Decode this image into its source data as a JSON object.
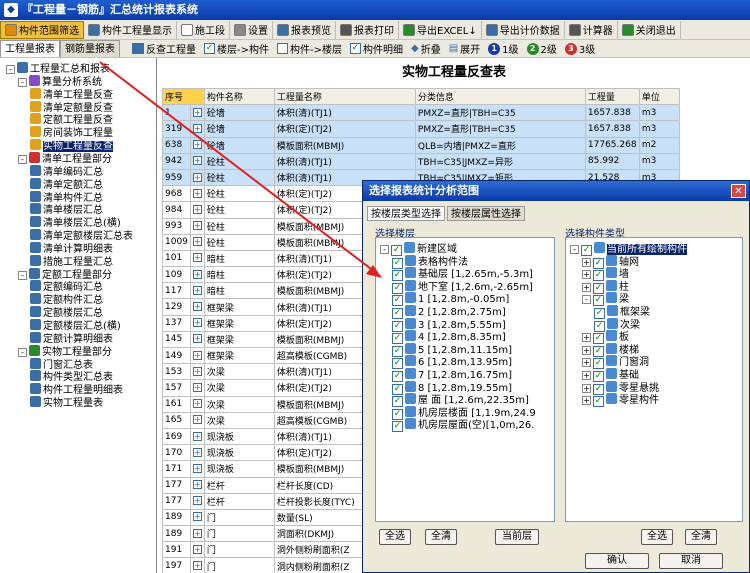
{
  "window": {
    "title": "『工程量－钢筋』汇总统计报表系统"
  },
  "toolbar": [
    {
      "label": "构件范围筛选",
      "icon": "filter-icon",
      "color": "#e08a00"
    },
    {
      "label": "构件工程量显示",
      "icon": "table-icon",
      "color": "#3a6ea5"
    },
    {
      "label": "施工段",
      "icon": "checkbox-icon",
      "color": "#ffffff"
    },
    {
      "label": "设置",
      "icon": "gear-icon",
      "color": "#888888"
    },
    {
      "label": "报表预览",
      "icon": "preview-icon",
      "color": "#3a6ea5"
    },
    {
      "label": "报表打印",
      "icon": "print-icon",
      "color": "#555555"
    },
    {
      "label": "导出EXCEL↓",
      "icon": "excel-icon",
      "color": "#2a8a2a"
    },
    {
      "label": "导出计价数据",
      "icon": "export-icon",
      "color": "#3a6ea5"
    },
    {
      "label": "计算器",
      "icon": "calculator-icon",
      "color": "#555555"
    },
    {
      "label": "关闭退出",
      "icon": "close-icon",
      "color": "#2a8a2a"
    }
  ],
  "left_tabs": [
    "工程量报表",
    "钢筋量报表"
  ],
  "toolbar2": {
    "reverse": "反查工程量",
    "floor_to_comp": "楼层->构件",
    "comp_to_floor": "构件->楼层",
    "comp_detail": "构件明细",
    "collapse": "折叠",
    "expand": "展开",
    "level1": "1级",
    "level2": "2级",
    "level3": "3级"
  },
  "tree": [
    {
      "label": "工程量汇总和报表",
      "level": 0,
      "exp": "-",
      "color": "#3a6ea5"
    },
    {
      "label": "算量分析系统",
      "level": 1,
      "exp": "-",
      "color": "#8a4ac8"
    },
    {
      "label": "清单工程量反查",
      "level": 2,
      "color": "#e0a020"
    },
    {
      "label": "清单定额量反查",
      "level": 2,
      "color": "#e0a020"
    },
    {
      "label": "定额工程量反查",
      "level": 2,
      "color": "#e0a020"
    },
    {
      "label": "房间装饰工程量",
      "level": 2,
      "color": "#e0a020"
    },
    {
      "label": "实物工程量反查",
      "level": 2,
      "color": "#e0a020",
      "selected": true
    },
    {
      "label": "清单工程量部分",
      "level": 1,
      "exp": "-",
      "color": "#d03030"
    },
    {
      "label": "清单编码汇总",
      "level": 2,
      "color": "#3a6ea5"
    },
    {
      "label": "清单定额汇总",
      "level": 2,
      "color": "#3a6ea5"
    },
    {
      "label": "清单构件汇总",
      "level": 2,
      "color": "#3a6ea5"
    },
    {
      "label": "清单楼层汇总",
      "level": 2,
      "color": "#3a6ea5"
    },
    {
      "label": "清单楼层汇总(横)",
      "level": 2,
      "color": "#3a6ea5"
    },
    {
      "label": "清单定额楼层汇总表",
      "level": 2,
      "color": "#3a6ea5"
    },
    {
      "label": "清单计算明细表",
      "level": 2,
      "color": "#3a6ea5"
    },
    {
      "label": "措施工程量汇总",
      "level": 2,
      "color": "#3a6ea5"
    },
    {
      "label": "定额工程量部分",
      "level": 1,
      "exp": "-",
      "color": "#3a6ea5"
    },
    {
      "label": "定额编码汇总",
      "level": 2,
      "color": "#3a6ea5"
    },
    {
      "label": "定额构件汇总",
      "level": 2,
      "color": "#3a6ea5"
    },
    {
      "label": "定额楼层汇总",
      "level": 2,
      "color": "#3a6ea5"
    },
    {
      "label": "定额楼层汇总(横)",
      "level": 2,
      "color": "#3a6ea5"
    },
    {
      "label": "定额计算明细表",
      "level": 2,
      "color": "#3a6ea5"
    },
    {
      "label": "实物工程量部分",
      "level": 1,
      "exp": "-",
      "color": "#2a8a2a"
    },
    {
      "label": "门窗汇总表",
      "level": 2,
      "color": "#3a6ea5"
    },
    {
      "label": "构件类型汇总表",
      "level": 2,
      "color": "#3a6ea5"
    },
    {
      "label": "构件工程量明细表",
      "level": 2,
      "color": "#3a6ea5"
    },
    {
      "label": "实物工程量表",
      "level": 2,
      "color": "#3a6ea5"
    }
  ],
  "report": {
    "title": "实物工程量反查表",
    "headers": [
      "序号",
      "构件名称",
      "工程量名称",
      "分类信息",
      "工程量",
      "单位"
    ],
    "rows": [
      [
        "1",
        "砼墙",
        "体积(清)(TJ1)",
        "PMXZ=直形|TBH=C35",
        "1657.838",
        "m3"
      ],
      [
        "319",
        "砼墙",
        "体积(定)(TJ2)",
        "PMXZ=直形|TBH=C35",
        "1657.838",
        "m3"
      ],
      [
        "638",
        "砼墙",
        "模板面积(MBMJ)",
        "QLB=内墙|PMXZ=直形",
        "17765.268",
        "m2"
      ],
      [
        "942",
        "砼柱",
        "体积(清)(TJ1)",
        "TBH=C35|JMXZ=异形",
        "85.992",
        "m3"
      ],
      [
        "959",
        "砼柱",
        "体积(清)(TJ1)",
        "TBH=C35|JMXZ=矩形",
        "21.528",
        "m3"
      ],
      [
        "968",
        "砼柱",
        "体积(定)(TJ2)",
        "",
        "",
        ""
      ],
      [
        "984",
        "砼柱",
        "体积(定)(TJ2)",
        "",
        "",
        ""
      ],
      [
        "993",
        "砼柱",
        "模板面积(MBMJ)",
        "",
        "",
        ""
      ],
      [
        "1009",
        "砼柱",
        "模板面积(MBMJ)",
        "",
        "",
        ""
      ],
      [
        "101",
        "暗柱",
        "体积(清)(TJ1)",
        "",
        "",
        ""
      ],
      [
        "109",
        "暗柱",
        "体积(定)(TJ2)",
        "",
        "",
        ""
      ],
      [
        "117",
        "暗柱",
        "模板面积(MBMJ)",
        "",
        "",
        ""
      ],
      [
        "129",
        "框架梁",
        "体积(清)(TJ1)",
        "",
        "",
        ""
      ],
      [
        "137",
        "框架梁",
        "体积(定)(TJ2)",
        "",
        "",
        ""
      ],
      [
        "145",
        "框架梁",
        "模板面积(MBMJ)",
        "",
        "",
        ""
      ],
      [
        "149",
        "框架梁",
        "超高模板(CGMB)",
        "",
        "",
        ""
      ],
      [
        "153",
        "次梁",
        "体积(清)(TJ1)",
        "",
        "",
        ""
      ],
      [
        "157",
        "次梁",
        "体积(定)(TJ2)",
        "",
        "",
        ""
      ],
      [
        "161",
        "次梁",
        "模板面积(MBMJ)",
        "",
        "",
        ""
      ],
      [
        "165",
        "次梁",
        "超高模板(CGMB)",
        "",
        "",
        ""
      ],
      [
        "169",
        "现浇板",
        "体积(清)(TJ1)",
        "",
        "",
        ""
      ],
      [
        "170",
        "现浇板",
        "体积(定)(TJ2)",
        "",
        "",
        ""
      ],
      [
        "171",
        "现浇板",
        "模板面积(MBMJ)",
        "",
        "",
        ""
      ],
      [
        "177",
        "栏杆",
        "栏杆长度(CD)",
        "",
        "",
        ""
      ],
      [
        "177",
        "栏杆",
        "栏杆投影长度(TYC)",
        "",
        "",
        ""
      ],
      [
        "189",
        "门",
        "数量(SL)",
        "",
        "",
        ""
      ],
      [
        "189",
        "门",
        "洞面积(DKMJ)",
        "",
        "",
        ""
      ],
      [
        "191",
        "门",
        "洞外侧粉刷面积(Z",
        "",
        "",
        ""
      ],
      [
        "197",
        "门",
        "洞内侧粉刷面积(Z",
        "",
        "",
        ""
      ]
    ]
  },
  "dialog": {
    "title": "选择报表统计分析范围",
    "tabs": [
      "按楼层类型选择",
      "按楼层属性选择"
    ],
    "floors_label": "选择楼层",
    "components_label": "选择构件类型",
    "floors": [
      {
        "label": "新建区域",
        "level": 0,
        "exp": "-"
      },
      {
        "label": "表格构件法",
        "level": 1
      },
      {
        "label": "基础层 [1,2.65m,-5.3m]",
        "level": 1
      },
      {
        "label": "地下室 [1,2.6m,-2.65m]",
        "level": 1
      },
      {
        "label": "1 [1,2.8m,-0.05m]",
        "level": 1
      },
      {
        "label": "2 [1,2.8m,2.75m]",
        "level": 1
      },
      {
        "label": "3 [1,2.8m,5.55m]",
        "level": 1
      },
      {
        "label": "4 [1,2.8m,8.35m]",
        "level": 1
      },
      {
        "label": "5 [1,2.8m,11.15m]",
        "level": 1
      },
      {
        "label": "6 [1,2.8m,13.95m]",
        "level": 1
      },
      {
        "label": "7 [1,2.8m,16.75m]",
        "level": 1
      },
      {
        "label": "8 [1,2.8m,19.55m]",
        "level": 1
      },
      {
        "label": "屋 面 [1,2.6m,22.35m]",
        "level": 1
      },
      {
        "label": "机房层楼面 [1,1.9m,24.9",
        "level": 1
      },
      {
        "label": "机房层屋面(空)[1,0m,26.",
        "level": 1
      }
    ],
    "components": [
      {
        "label": "当前所有绘制构件",
        "level": 0,
        "exp": "-",
        "selected": true
      },
      {
        "label": "轴网",
        "level": 1,
        "exp": "+"
      },
      {
        "label": "墙",
        "level": 1,
        "exp": "+"
      },
      {
        "label": "柱",
        "level": 1,
        "exp": "+"
      },
      {
        "label": "梁",
        "level": 1,
        "exp": "-"
      },
      {
        "label": "框架梁",
        "level": 2
      },
      {
        "label": "次梁",
        "level": 2
      },
      {
        "label": "板",
        "level": 1,
        "exp": "+"
      },
      {
        "label": "楼梯",
        "level": 1,
        "exp": "+"
      },
      {
        "label": "门窗洞",
        "level": 1,
        "exp": "+"
      },
      {
        "label": "基础",
        "level": 1,
        "exp": "+"
      },
      {
        "label": "零星悬挑",
        "level": 1,
        "exp": "+"
      },
      {
        "label": "零星构件",
        "level": 1,
        "exp": "+"
      }
    ],
    "buttons": {
      "select_all": "全选",
      "clear_all": "全清",
      "current_floor": "当前层",
      "select_all2": "全选",
      "clear_all2": "全清",
      "ok": "确认",
      "cancel": "取消"
    }
  },
  "annotation": {
    "color": "#e02020"
  }
}
